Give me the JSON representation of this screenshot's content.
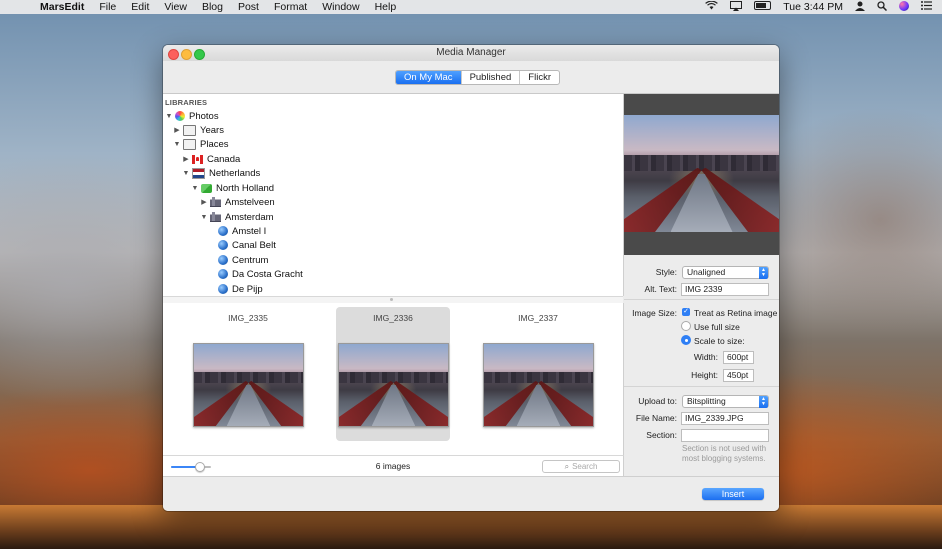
{
  "menubar": {
    "app_name": "MarsEdit",
    "items": [
      "File",
      "Edit",
      "View",
      "Blog",
      "Post",
      "Format",
      "Window",
      "Help"
    ],
    "clock": "Tue 3:44 PM"
  },
  "window": {
    "title": "Media Manager"
  },
  "tabs": [
    {
      "label": "On My Mac",
      "active": true
    },
    {
      "label": "Published",
      "active": false
    },
    {
      "label": "Flickr",
      "active": false
    }
  ],
  "library": {
    "header": "LIBRARIES",
    "items": [
      {
        "label": "Photos",
        "expanded": true,
        "icon": "photos-icon",
        "depth": 0
      },
      {
        "label": "Years",
        "expanded": false,
        "icon": "folder-icon",
        "depth": 1
      },
      {
        "label": "Places",
        "expanded": true,
        "icon": "folder-icon",
        "depth": 1
      },
      {
        "label": "Canada",
        "expanded": false,
        "icon": "flag-canada-icon",
        "depth": 2
      },
      {
        "label": "Netherlands",
        "expanded": true,
        "icon": "flag-netherlands-icon",
        "depth": 2
      },
      {
        "label": "North Holland",
        "expanded": true,
        "icon": "map-icon",
        "depth": 3
      },
      {
        "label": "Amstelveen",
        "expanded": false,
        "icon": "city-icon",
        "depth": 4
      },
      {
        "label": "Amsterdam",
        "expanded": true,
        "icon": "city-icon",
        "depth": 4
      },
      {
        "label": "Amstel I",
        "icon": "globe-icon",
        "depth": 5
      },
      {
        "label": "Canal Belt",
        "icon": "globe-icon",
        "depth": 5
      },
      {
        "label": "Centrum",
        "icon": "globe-icon",
        "depth": 5
      },
      {
        "label": "Da Costa Gracht",
        "icon": "globe-icon",
        "depth": 5
      },
      {
        "label": "De Pijp",
        "icon": "globe-icon",
        "depth": 5
      }
    ]
  },
  "thumbnails": [
    {
      "name": "IMG_2335",
      "selected": false
    },
    {
      "name": "IMG_2336",
      "selected": true
    },
    {
      "name": "IMG_2337",
      "selected": false
    }
  ],
  "footer": {
    "count": "6 images",
    "search_placeholder": "Search",
    "zoom_level": 0.7
  },
  "settings": {
    "style_label": "Style:",
    "style_value": "Unaligned",
    "alt_label": "Alt. Text:",
    "alt_value": "IMG 2339",
    "image_size_label": "Image Size:",
    "retina_label": "Treat as Retina image",
    "retina_checked": true,
    "use_full_size": "Use full size",
    "scale_to_size": "Scale to size:",
    "width_label": "Width:",
    "width_value": "600pt",
    "height_label": "Height:",
    "height_value": "450pt",
    "upload_label": "Upload to:",
    "upload_value": "Bitsplitting",
    "filename_label": "File Name:",
    "filename_value": "IMG_2339.JPG",
    "section_label": "Section:",
    "section_value": "",
    "note": "Section is not used with most blogging systems."
  },
  "insert_label": "Insert",
  "colors": {
    "accent": "#1c6ff0",
    "selection": "#dcdcdc"
  }
}
